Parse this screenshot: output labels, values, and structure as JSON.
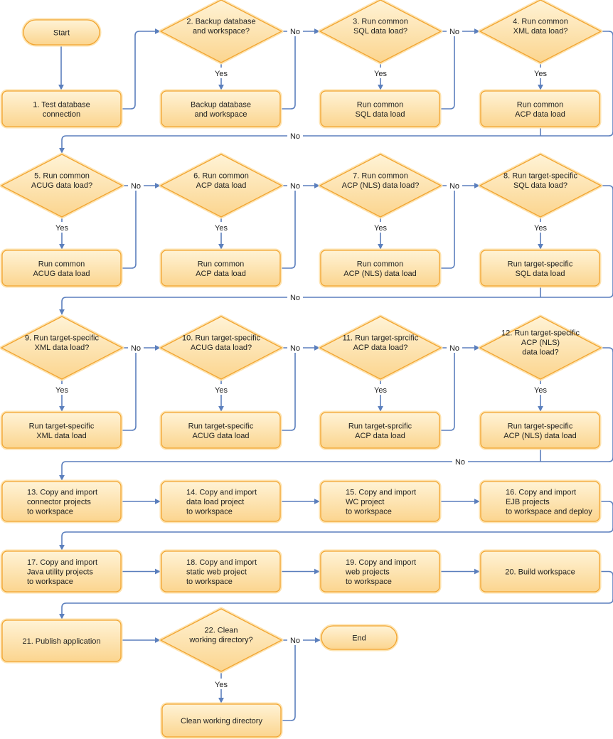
{
  "colors": {
    "node_fill_top": "#fff3d6",
    "node_fill_bottom": "#fbd58f",
    "node_stroke": "#f2a531",
    "edge": "#5b7fbd"
  },
  "labels": {
    "yes": "Yes",
    "no": "No"
  },
  "nodes": {
    "start": [
      "Start"
    ],
    "n1": [
      "1. Test database",
      "connection"
    ],
    "d2": [
      "2. Backup database",
      "and workspace?"
    ],
    "b2": [
      "Backup database",
      "and workspace"
    ],
    "d3": [
      "3. Run common",
      "SQL data load?"
    ],
    "b3": [
      "Run common",
      "SQL data load"
    ],
    "d4": [
      "4. Run common",
      "XML data load?"
    ],
    "b4": [
      "Run common",
      "ACP data load"
    ],
    "d5": [
      "5. Run common",
      "ACUG data load?"
    ],
    "b5": [
      "Run common",
      "ACUG data load"
    ],
    "d6": [
      "6. Run common",
      "ACP data load"
    ],
    "b6": [
      "Run common",
      "ACP data load"
    ],
    "d7": [
      "7. Run common",
      "ACP (NLS) data load?"
    ],
    "b7": [
      "Run common",
      "ACP (NLS) data load"
    ],
    "d8": [
      "8. Run target-specific",
      "SQL data load?"
    ],
    "b8": [
      "Run target-specific",
      "SQL data load"
    ],
    "d9": [
      "9. Run target-specific",
      "XML data load?"
    ],
    "b9": [
      "Run target-specific",
      "XML data load"
    ],
    "d10": [
      "10. Run target-specific",
      "ACUG data load?"
    ],
    "b10": [
      "Run target-specific",
      "ACUG data load"
    ],
    "d11": [
      "11. Run target-sprcific",
      "ACP data load?"
    ],
    "b11": [
      "Run target-sprcific",
      "ACP data load"
    ],
    "d12": [
      "12. Run target-specific",
      "ACP (NLS)",
      "data load?"
    ],
    "b12": [
      "Run target-specific",
      "ACP (NLS) data load"
    ],
    "n13": [
      "13. Copy and import",
      "connector projects",
      "to workspace"
    ],
    "n14": [
      "14. Copy and import",
      "data load project",
      "to workspace"
    ],
    "n15": [
      "15. Copy and import",
      "WC project",
      "to workspace"
    ],
    "n16": [
      "16. Copy and import",
      "EJB projects",
      "to workspace and deploy"
    ],
    "n17": [
      "17. Copy and import",
      "Java utility projects",
      "to workspace"
    ],
    "n18": [
      "18. Copy and import",
      "static web project",
      "to workspace"
    ],
    "n19": [
      "19. Copy and import",
      "web projects",
      "to workspace"
    ],
    "n20": [
      "20. Build workspace"
    ],
    "n21": [
      "21. Publish application"
    ],
    "d22": [
      "22. Clean",
      "working directory?"
    ],
    "b22": [
      "Clean working directory"
    ],
    "end": [
      "End"
    ]
  }
}
